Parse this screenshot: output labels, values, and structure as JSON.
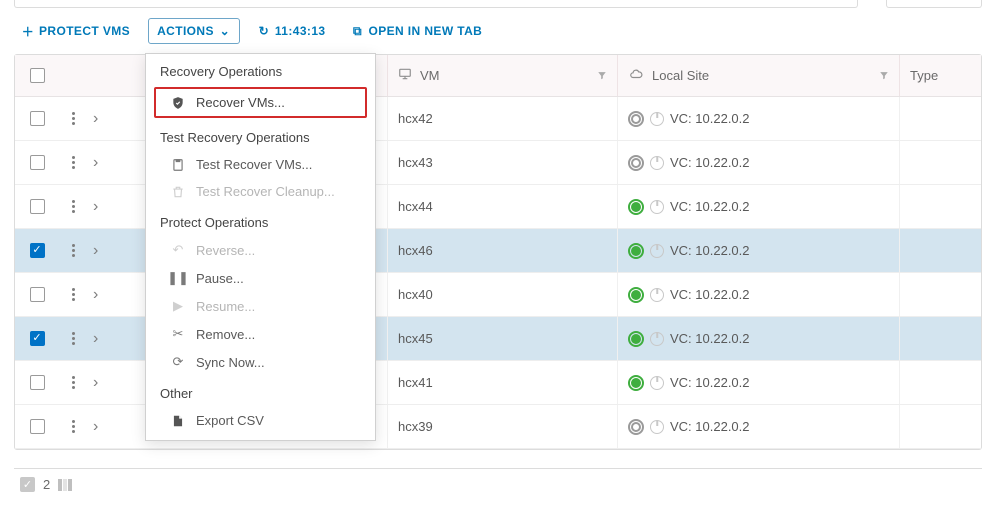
{
  "toolbar": {
    "protect": "PROTECT VMS",
    "actions": "ACTIONS",
    "time": "11:43:13",
    "open_tab": "OPEN IN NEW TAB"
  },
  "columns": {
    "vm": "VM",
    "local_site": "Local Site",
    "type": "Type"
  },
  "menu": {
    "g1": "Recovery Operations",
    "recover": "Recover VMs...",
    "g2": "Test Recovery Operations",
    "test_recover": "Test Recover VMs...",
    "test_cleanup": "Test Recover Cleanup...",
    "g3": "Protect Operations",
    "reverse": "Reverse...",
    "pause": "Pause...",
    "resume": "Resume...",
    "remove": "Remove...",
    "sync": "Sync Now...",
    "g4": "Other",
    "export": "Export CSV"
  },
  "rows": [
    {
      "vm": "hcx42",
      "site": "VC: 10.22.0.2",
      "status": "grey",
      "selected": false
    },
    {
      "vm": "hcx43",
      "site": "VC: 10.22.0.2",
      "status": "grey",
      "selected": false
    },
    {
      "vm": "hcx44",
      "site": "VC: 10.22.0.2",
      "status": "green",
      "selected": false
    },
    {
      "vm": "hcx46",
      "site": "VC: 10.22.0.2",
      "status": "green",
      "selected": true
    },
    {
      "vm": "hcx40",
      "site": "VC: 10.22.0.2",
      "status": "green",
      "selected": false
    },
    {
      "vm": "hcx45",
      "site": "VC: 10.22.0.2",
      "status": "green",
      "selected": true
    },
    {
      "vm": "hcx41",
      "site": "VC: 10.22.0.2",
      "status": "green",
      "selected": false
    },
    {
      "vm": "hcx39",
      "site": "VC: 10.22.0.2",
      "status": "grey",
      "selected": false
    }
  ],
  "footer": {
    "count": "2"
  }
}
